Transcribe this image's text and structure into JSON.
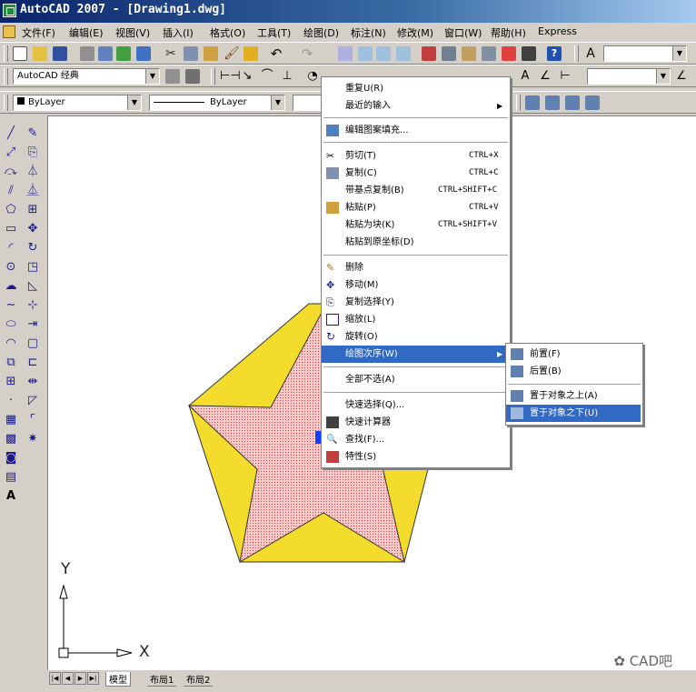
{
  "window": {
    "title": "AutoCAD 2007 - [Drawing1.dwg]"
  },
  "menubar": {
    "items": [
      "文件(F)",
      "编辑(E)",
      "视图(V)",
      "插入(I)",
      "格式(O)",
      "工具(T)",
      "绘图(D)",
      "标注(N)",
      "修改(M)",
      "窗口(W)",
      "帮助(H)",
      "Express"
    ]
  },
  "toolbar": {
    "workspace": "AutoCAD 经典",
    "layer_color": "ByLayer",
    "linetype": "ByLayer"
  },
  "context_menu": {
    "items": [
      {
        "label": "重复U(R)",
        "shortcut": "",
        "icon": "",
        "submenu": false
      },
      {
        "label": "最近的输入",
        "shortcut": "",
        "icon": "",
        "submenu": true
      },
      {
        "label": "编辑图案填充...",
        "shortcut": "",
        "icon": "hatch-edit-icon",
        "submenu": false
      },
      {
        "label": "剪切(T)",
        "shortcut": "CTRL+X",
        "icon": "scissors-icon",
        "submenu": false
      },
      {
        "label": "复制(C)",
        "shortcut": "CTRL+C",
        "icon": "copy-icon",
        "submenu": false
      },
      {
        "label": "带基点复制(B)",
        "shortcut": "CTRL+SHIFT+C",
        "icon": "",
        "submenu": false
      },
      {
        "label": "粘贴(P)",
        "shortcut": "CTRL+V",
        "icon": "paste-icon",
        "submenu": false
      },
      {
        "label": "粘贴为块(K)",
        "shortcut": "CTRL+SHIFT+V",
        "icon": "",
        "submenu": false
      },
      {
        "label": "粘贴到原坐标(D)",
        "shortcut": "",
        "icon": "",
        "submenu": false
      },
      {
        "label": "删除",
        "shortcut": "",
        "icon": "eraser-icon",
        "submenu": false
      },
      {
        "label": "移动(M)",
        "shortcut": "",
        "icon": "move-icon",
        "submenu": false
      },
      {
        "label": "复制选择(Y)",
        "shortcut": "",
        "icon": "copy-select-icon",
        "submenu": false
      },
      {
        "label": "缩放(L)",
        "shortcut": "",
        "icon": "scale-icon",
        "submenu": false
      },
      {
        "label": "旋转(O)",
        "shortcut": "",
        "icon": "rotate-icon",
        "submenu": false
      },
      {
        "label": "绘图次序(W)",
        "shortcut": "",
        "icon": "",
        "submenu": true
      },
      {
        "label": "全部不选(A)",
        "shortcut": "",
        "icon": "",
        "submenu": false
      },
      {
        "label": "快速选择(Q)...",
        "shortcut": "",
        "icon": "",
        "submenu": false
      },
      {
        "label": "快速计算器",
        "shortcut": "",
        "icon": "calculator-icon",
        "submenu": false
      },
      {
        "label": "查找(F)...",
        "shortcut": "",
        "icon": "find-icon",
        "submenu": false
      },
      {
        "label": "特性(S)",
        "shortcut": "",
        "icon": "properties-icon",
        "submenu": false
      }
    ],
    "highlighted": "绘图次序(W)"
  },
  "submenu": {
    "items": [
      {
        "label": "前置(F)",
        "icon": "bring-front-icon"
      },
      {
        "label": "后置(B)",
        "icon": "send-back-icon"
      },
      {
        "label": "置于对象之上(A)",
        "icon": "bring-above-icon"
      },
      {
        "label": "置于对象之下(U)",
        "icon": "send-under-icon"
      }
    ],
    "highlighted": "置于对象之下(U)"
  },
  "canvas": {
    "ucs_x_label": "X",
    "ucs_y_label": "Y",
    "pentagon_color": "#f4dc2c",
    "star_color": "#f0a0a0"
  },
  "tabs": {
    "items": [
      "模型",
      "布局1",
      "布局2"
    ],
    "active": "模型"
  },
  "watermark": "CAD吧",
  "colors": {
    "title_bar": "#0a246a",
    "highlight": "#316ac5"
  }
}
